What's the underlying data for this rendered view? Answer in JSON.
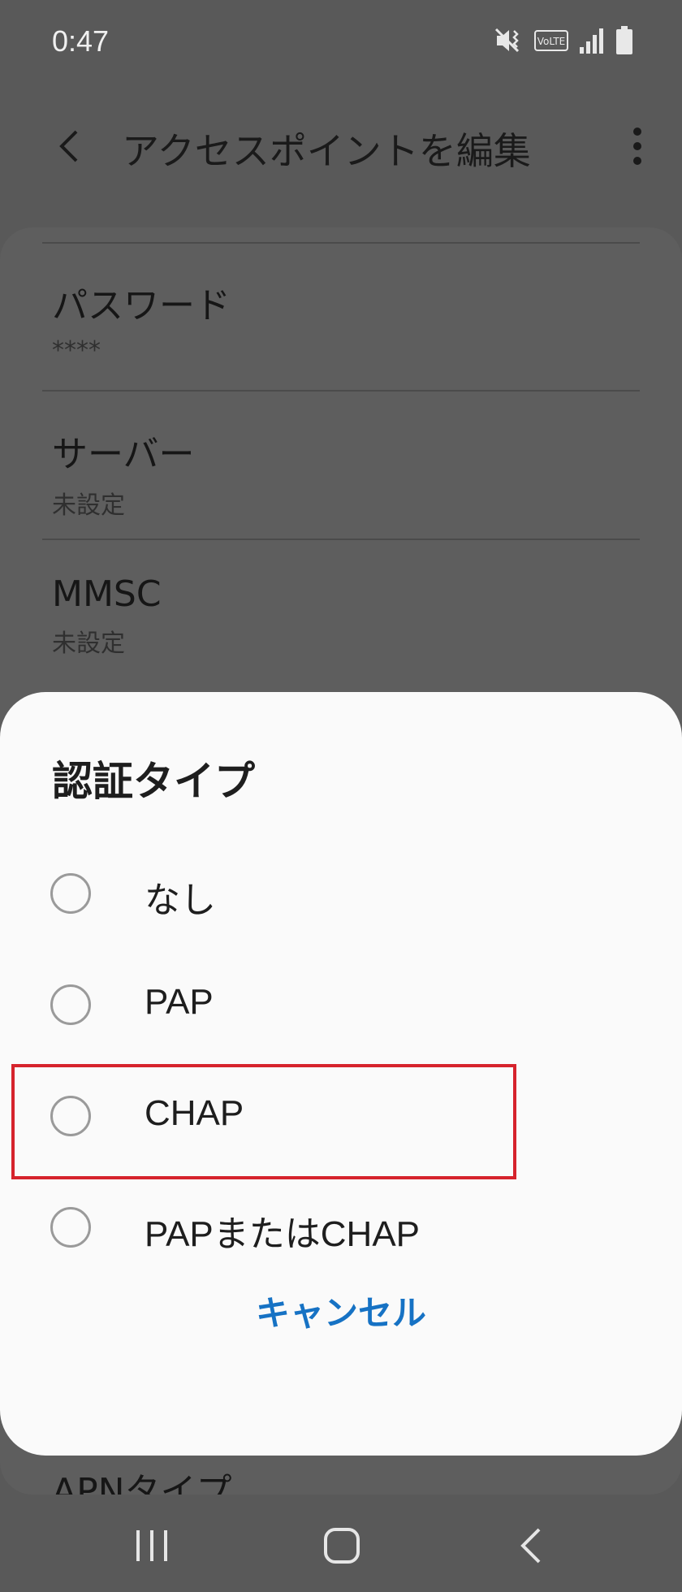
{
  "status_bar": {
    "time": "0:47",
    "icons": [
      "mute-icon",
      "volte-icon",
      "signal-icon",
      "battery-icon"
    ],
    "volte_label": "VoLTE"
  },
  "app_bar": {
    "title": "アクセスポイントを編集",
    "back_icon": "back-arrow-icon",
    "more_icon": "more-vert-icon"
  },
  "settings": {
    "items": [
      {
        "title": "パスワード",
        "value": "****"
      },
      {
        "title": "サーバー",
        "value": "未設定"
      },
      {
        "title": "MMSC",
        "value": "未設定"
      }
    ],
    "peek_item": "APNタイプ"
  },
  "dialog": {
    "title": "認証タイプ",
    "options": [
      {
        "label": "なし",
        "selected": false
      },
      {
        "label": "PAP",
        "selected": false
      },
      {
        "label": "CHAP",
        "selected": false
      },
      {
        "label": "PAPまたはCHAP",
        "selected": false
      }
    ],
    "highlighted_option": "CHAP",
    "cancel_label": "キャンセル"
  },
  "colors": {
    "accent": "#1672c4",
    "highlight": "#d6232c",
    "dim_background": "#595959",
    "dialog_background": "#fafafa"
  },
  "nav_bar": {
    "buttons": [
      "recent-apps-icon",
      "home-icon",
      "back-icon"
    ]
  }
}
